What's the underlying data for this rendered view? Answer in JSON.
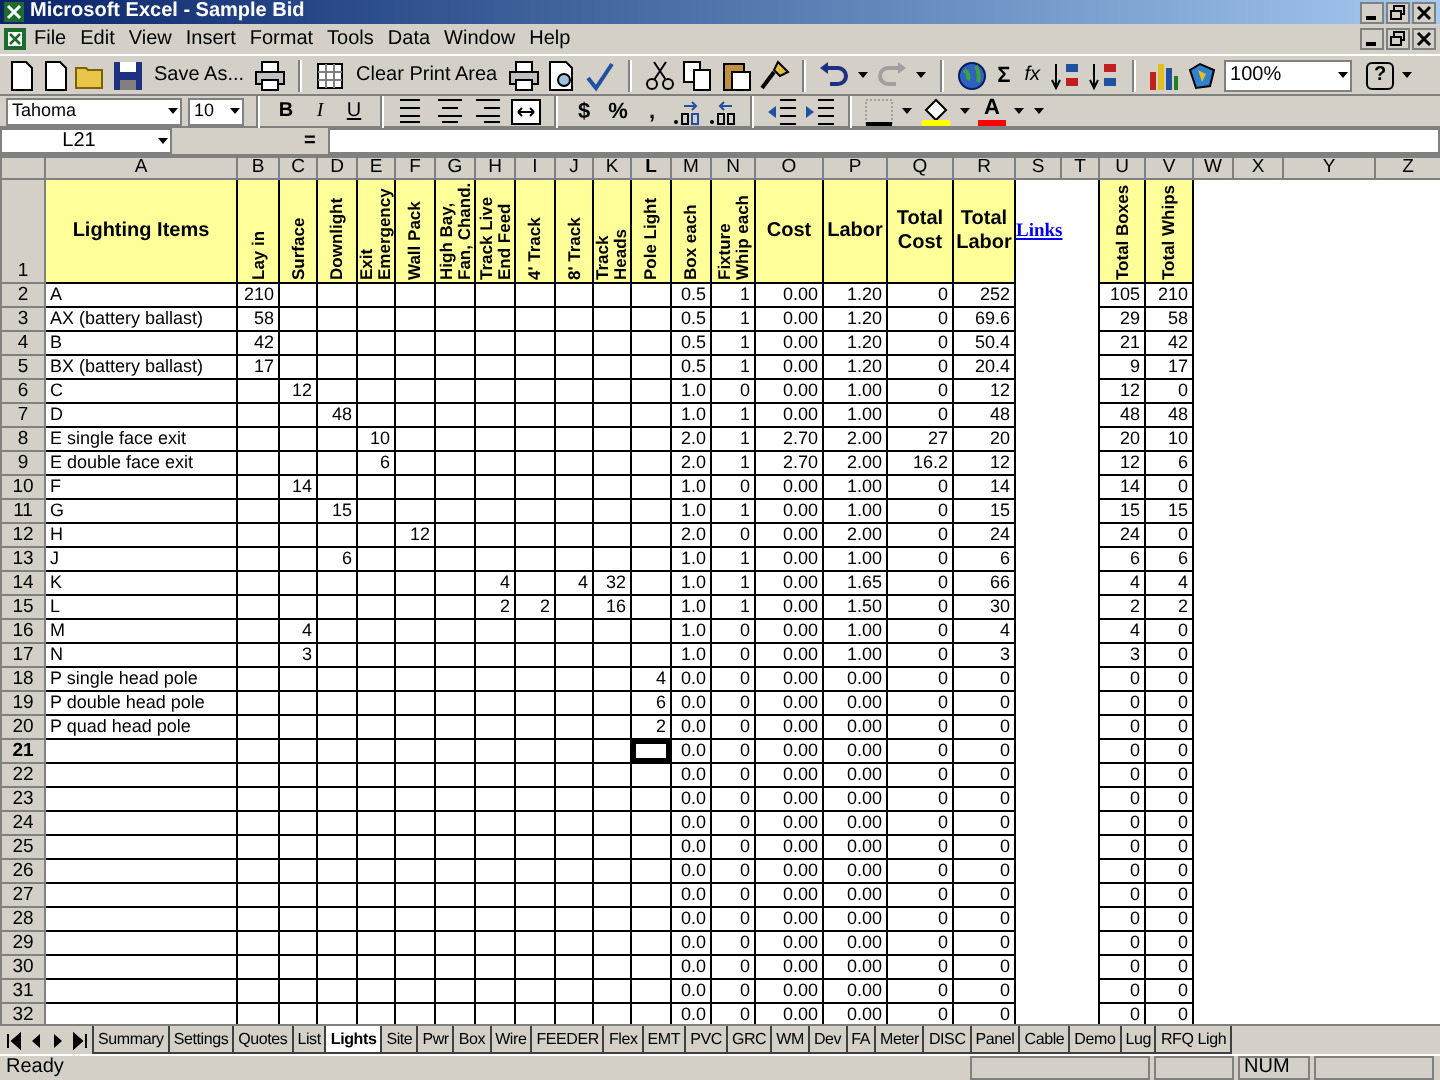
{
  "window": {
    "title": "Microsoft Excel - Sample Bid"
  },
  "menu": [
    "File",
    "Edit",
    "View",
    "Insert",
    "Format",
    "Tools",
    "Data",
    "Window",
    "Help"
  ],
  "toolbar": {
    "save_as": "Save As...",
    "clear_print_area": "Clear Print Area",
    "sum": "Σ",
    "function": "fx",
    "zoom": "100%",
    "help": "?"
  },
  "format_bar": {
    "font": "Tahoma",
    "size": "10",
    "style_buttons": [
      "B",
      "I",
      "U"
    ],
    "number_buttons": [
      "$",
      "%",
      ","
    ],
    "font_color": "A"
  },
  "formula_bar": {
    "name_box": "L21",
    "equals": "="
  },
  "columns": [
    {
      "letter": "A",
      "selected": false
    },
    {
      "letter": "B",
      "selected": false
    },
    {
      "letter": "C",
      "selected": false
    },
    {
      "letter": "D",
      "selected": false
    },
    {
      "letter": "E",
      "selected": false
    },
    {
      "letter": "F",
      "selected": false
    },
    {
      "letter": "G",
      "selected": false
    },
    {
      "letter": "H",
      "selected": false
    },
    {
      "letter": "I",
      "selected": false
    },
    {
      "letter": "J",
      "selected": false
    },
    {
      "letter": "K",
      "selected": false
    },
    {
      "letter": "L",
      "selected": true
    },
    {
      "letter": "M",
      "selected": false
    },
    {
      "letter": "N",
      "selected": false
    },
    {
      "letter": "O",
      "selected": false
    },
    {
      "letter": "P",
      "selected": false
    },
    {
      "letter": "Q",
      "selected": false
    },
    {
      "letter": "R",
      "selected": false
    },
    {
      "letter": "S",
      "selected": false
    },
    {
      "letter": "T",
      "selected": false
    },
    {
      "letter": "U",
      "selected": false
    },
    {
      "letter": "V",
      "selected": false
    },
    {
      "letter": "W",
      "selected": false
    },
    {
      "letter": "X",
      "selected": false
    },
    {
      "letter": "Y",
      "selected": false
    },
    {
      "letter": "Z",
      "selected": false
    }
  ],
  "header_row": {
    "row": "1",
    "cells": [
      {
        "text": "Lighting Items",
        "kind": "horizontal"
      },
      {
        "text": "Lay in",
        "kind": "vertical"
      },
      {
        "text": "Surface",
        "kind": "vertical"
      },
      {
        "text": "Downlight",
        "kind": "vertical"
      },
      {
        "text": "Exit Emergency",
        "kind": "vertical"
      },
      {
        "text": "Wall Pack",
        "kind": "vertical"
      },
      {
        "text": "High Bay, Fan, Chand.",
        "kind": "vertical"
      },
      {
        "text": "Track Live End Feed",
        "kind": "vertical"
      },
      {
        "text": "4' Track",
        "kind": "vertical"
      },
      {
        "text": "8' Track",
        "kind": "vertical"
      },
      {
        "text": "Track Heads",
        "kind": "vertical"
      },
      {
        "text": "Pole Light",
        "kind": "vertical"
      },
      {
        "text": "Box each",
        "kind": "vertical"
      },
      {
        "text": "Fixture Whip each",
        "kind": "vertical"
      },
      {
        "text": "Cost",
        "kind": "horizontal"
      },
      {
        "text": "Labor",
        "kind": "horizontal"
      },
      {
        "text": "Total Cost",
        "kind": "horizontal"
      },
      {
        "text": "Total Labor",
        "kind": "horizontal"
      },
      {
        "text": "Links",
        "kind": "link"
      },
      null,
      {
        "text": "Total Boxes",
        "kind": "vertical"
      },
      {
        "text": "Total Whips",
        "kind": "vertical"
      }
    ]
  },
  "rows": [
    {
      "row": "2",
      "selected": false,
      "cells": [
        "A",
        "210",
        null,
        null,
        null,
        null,
        null,
        null,
        null,
        null,
        null,
        null,
        "0.5",
        "1",
        "0.00",
        "1.20",
        "0",
        "252",
        null,
        null,
        "105",
        "210"
      ]
    },
    {
      "row": "3",
      "selected": false,
      "cells": [
        "AX (battery ballast)",
        "58",
        null,
        null,
        null,
        null,
        null,
        null,
        null,
        null,
        null,
        null,
        "0.5",
        "1",
        "0.00",
        "1.20",
        "0",
        "69.6",
        null,
        null,
        "29",
        "58"
      ]
    },
    {
      "row": "4",
      "selected": false,
      "cells": [
        "B",
        "42",
        null,
        null,
        null,
        null,
        null,
        null,
        null,
        null,
        null,
        null,
        "0.5",
        "1",
        "0.00",
        "1.20",
        "0",
        "50.4",
        null,
        null,
        "21",
        "42"
      ]
    },
    {
      "row": "5",
      "selected": false,
      "cells": [
        "BX (battery ballast)",
        "17",
        null,
        null,
        null,
        null,
        null,
        null,
        null,
        null,
        null,
        null,
        "0.5",
        "1",
        "0.00",
        "1.20",
        "0",
        "20.4",
        null,
        null,
        "9",
        "17"
      ]
    },
    {
      "row": "6",
      "selected": false,
      "cells": [
        "C",
        null,
        "12",
        null,
        null,
        null,
        null,
        null,
        null,
        null,
        null,
        null,
        "1.0",
        "0",
        "0.00",
        "1.00",
        "0",
        "12",
        null,
        null,
        "12",
        "0"
      ]
    },
    {
      "row": "7",
      "selected": false,
      "cells": [
        "D",
        null,
        null,
        "48",
        null,
        null,
        null,
        null,
        null,
        null,
        null,
        null,
        "1.0",
        "1",
        "0.00",
        "1.00",
        "0",
        "48",
        null,
        null,
        "48",
        "48"
      ]
    },
    {
      "row": "8",
      "selected": false,
      "cells": [
        "E single face exit",
        null,
        null,
        null,
        "10",
        null,
        null,
        null,
        null,
        null,
        null,
        null,
        "2.0",
        "1",
        "2.70",
        "2.00",
        "27",
        "20",
        null,
        null,
        "20",
        "10"
      ]
    },
    {
      "row": "9",
      "selected": false,
      "cells": [
        "E double face exit",
        null,
        null,
        null,
        "6",
        null,
        null,
        null,
        null,
        null,
        null,
        null,
        "2.0",
        "1",
        "2.70",
        "2.00",
        "16.2",
        "12",
        null,
        null,
        "12",
        "6"
      ]
    },
    {
      "row": "10",
      "selected": false,
      "cells": [
        "F",
        null,
        "14",
        null,
        null,
        null,
        null,
        null,
        null,
        null,
        null,
        null,
        "1.0",
        "0",
        "0.00",
        "1.00",
        "0",
        "14",
        null,
        null,
        "14",
        "0"
      ]
    },
    {
      "row": "11",
      "selected": false,
      "cells": [
        "G",
        null,
        null,
        "15",
        null,
        null,
        null,
        null,
        null,
        null,
        null,
        null,
        "1.0",
        "1",
        "0.00",
        "1.00",
        "0",
        "15",
        null,
        null,
        "15",
        "15"
      ]
    },
    {
      "row": "12",
      "selected": false,
      "cells": [
        "H",
        null,
        null,
        null,
        null,
        "12",
        null,
        null,
        null,
        null,
        null,
        null,
        "2.0",
        "0",
        "0.00",
        "2.00",
        "0",
        "24",
        null,
        null,
        "24",
        "0"
      ]
    },
    {
      "row": "13",
      "selected": false,
      "cells": [
        "J",
        null,
        null,
        "6",
        null,
        null,
        null,
        null,
        null,
        null,
        null,
        null,
        "1.0",
        "1",
        "0.00",
        "1.00",
        "0",
        "6",
        null,
        null,
        "6",
        "6"
      ]
    },
    {
      "row": "14",
      "selected": false,
      "cells": [
        "K",
        null,
        null,
        null,
        null,
        null,
        null,
        "4",
        null,
        "4",
        "32",
        null,
        "1.0",
        "1",
        "0.00",
        "1.65",
        "0",
        "66",
        null,
        null,
        "4",
        "4"
      ]
    },
    {
      "row": "15",
      "selected": false,
      "cells": [
        "L",
        null,
        null,
        null,
        null,
        null,
        null,
        "2",
        "2",
        null,
        "16",
        null,
        "1.0",
        "1",
        "0.00",
        "1.50",
        "0",
        "30",
        null,
        null,
        "2",
        "2"
      ]
    },
    {
      "row": "16",
      "selected": false,
      "cells": [
        "M",
        null,
        "4",
        null,
        null,
        null,
        null,
        null,
        null,
        null,
        null,
        null,
        "1.0",
        "0",
        "0.00",
        "1.00",
        "0",
        "4",
        null,
        null,
        "4",
        "0"
      ]
    },
    {
      "row": "17",
      "selected": false,
      "cells": [
        "N",
        null,
        "3",
        null,
        null,
        null,
        null,
        null,
        null,
        null,
        null,
        null,
        "1.0",
        "0",
        "0.00",
        "1.00",
        "0",
        "3",
        null,
        null,
        "3",
        "0"
      ]
    },
    {
      "row": "18",
      "selected": false,
      "cells": [
        "P single head pole",
        null,
        null,
        null,
        null,
        null,
        null,
        null,
        null,
        null,
        null,
        "4",
        "0.0",
        "0",
        "0.00",
        "0.00",
        "0",
        "0",
        null,
        null,
        "0",
        "0"
      ]
    },
    {
      "row": "19",
      "selected": false,
      "cells": [
        "P double head pole",
        null,
        null,
        null,
        null,
        null,
        null,
        null,
        null,
        null,
        null,
        "6",
        "0.0",
        "0",
        "0.00",
        "0.00",
        "0",
        "0",
        null,
        null,
        "0",
        "0"
      ]
    },
    {
      "row": "20",
      "selected": false,
      "cells": [
        "P quad head pole",
        null,
        null,
        null,
        null,
        null,
        null,
        null,
        null,
        null,
        null,
        "2",
        "0.0",
        "0",
        "0.00",
        "0.00",
        "0",
        "0",
        null,
        null,
        "0",
        "0"
      ]
    },
    {
      "row": "21",
      "selected": true,
      "cells": [
        null,
        null,
        null,
        null,
        null,
        null,
        null,
        null,
        null,
        null,
        null,
        null,
        "0.0",
        "0",
        "0.00",
        "0.00",
        "0",
        "0",
        null,
        null,
        "0",
        "0"
      ]
    },
    {
      "row": "22",
      "selected": false,
      "cells": [
        null,
        null,
        null,
        null,
        null,
        null,
        null,
        null,
        null,
        null,
        null,
        null,
        "0.0",
        "0",
        "0.00",
        "0.00",
        "0",
        "0",
        null,
        null,
        "0",
        "0"
      ]
    },
    {
      "row": "23",
      "selected": false,
      "cells": [
        null,
        null,
        null,
        null,
        null,
        null,
        null,
        null,
        null,
        null,
        null,
        null,
        "0.0",
        "0",
        "0.00",
        "0.00",
        "0",
        "0",
        null,
        null,
        "0",
        "0"
      ]
    },
    {
      "row": "24",
      "selected": false,
      "cells": [
        null,
        null,
        null,
        null,
        null,
        null,
        null,
        null,
        null,
        null,
        null,
        null,
        "0.0",
        "0",
        "0.00",
        "0.00",
        "0",
        "0",
        null,
        null,
        "0",
        "0"
      ]
    },
    {
      "row": "25",
      "selected": false,
      "cells": [
        null,
        null,
        null,
        null,
        null,
        null,
        null,
        null,
        null,
        null,
        null,
        null,
        "0.0",
        "0",
        "0.00",
        "0.00",
        "0",
        "0",
        null,
        null,
        "0",
        "0"
      ]
    },
    {
      "row": "26",
      "selected": false,
      "cells": [
        null,
        null,
        null,
        null,
        null,
        null,
        null,
        null,
        null,
        null,
        null,
        null,
        "0.0",
        "0",
        "0.00",
        "0.00",
        "0",
        "0",
        null,
        null,
        "0",
        "0"
      ]
    },
    {
      "row": "27",
      "selected": false,
      "cells": [
        null,
        null,
        null,
        null,
        null,
        null,
        null,
        null,
        null,
        null,
        null,
        null,
        "0.0",
        "0",
        "0.00",
        "0.00",
        "0",
        "0",
        null,
        null,
        "0",
        "0"
      ]
    },
    {
      "row": "28",
      "selected": false,
      "cells": [
        null,
        null,
        null,
        null,
        null,
        null,
        null,
        null,
        null,
        null,
        null,
        null,
        "0.0",
        "0",
        "0.00",
        "0.00",
        "0",
        "0",
        null,
        null,
        "0",
        "0"
      ]
    },
    {
      "row": "29",
      "selected": false,
      "cells": [
        null,
        null,
        null,
        null,
        null,
        null,
        null,
        null,
        null,
        null,
        null,
        null,
        "0.0",
        "0",
        "0.00",
        "0.00",
        "0",
        "0",
        null,
        null,
        "0",
        "0"
      ]
    },
    {
      "row": "30",
      "selected": false,
      "cells": [
        null,
        null,
        null,
        null,
        null,
        null,
        null,
        null,
        null,
        null,
        null,
        null,
        "0.0",
        "0",
        "0.00",
        "0.00",
        "0",
        "0",
        null,
        null,
        "0",
        "0"
      ]
    },
    {
      "row": "31",
      "selected": false,
      "cells": [
        null,
        null,
        null,
        null,
        null,
        null,
        null,
        null,
        null,
        null,
        null,
        null,
        "0.0",
        "0",
        "0.00",
        "0.00",
        "0",
        "0",
        null,
        null,
        "0",
        "0"
      ]
    },
    {
      "row": "32",
      "selected": false,
      "cells": [
        null,
        null,
        null,
        null,
        null,
        null,
        null,
        null,
        null,
        null,
        null,
        null,
        "0.0",
        "0",
        "0.00",
        "0.00",
        "0",
        "0",
        null,
        null,
        "0",
        "0"
      ]
    }
  ],
  "sheet_tabs": [
    {
      "label": "Summary",
      "selected": false
    },
    {
      "label": "Settings",
      "selected": false
    },
    {
      "label": "Quotes",
      "selected": false
    },
    {
      "label": "List",
      "selected": false
    },
    {
      "label": "Lights",
      "selected": true
    },
    {
      "label": "Site",
      "selected": false
    },
    {
      "label": "Pwr",
      "selected": false
    },
    {
      "label": "Box",
      "selected": false
    },
    {
      "label": "Wire",
      "selected": false
    },
    {
      "label": "FEEDER",
      "selected": false
    },
    {
      "label": "Flex",
      "selected": false
    },
    {
      "label": "EMT",
      "selected": false
    },
    {
      "label": "PVC",
      "selected": false
    },
    {
      "label": "GRC",
      "selected": false
    },
    {
      "label": "WM",
      "selected": false
    },
    {
      "label": "Dev",
      "selected": false
    },
    {
      "label": "FA",
      "selected": false
    },
    {
      "label": "Meter",
      "selected": false
    },
    {
      "label": "DISC",
      "selected": false
    },
    {
      "label": "Panel",
      "selected": false
    },
    {
      "label": "Cable",
      "selected": false
    },
    {
      "label": "Demo",
      "selected": false
    },
    {
      "label": "Lug",
      "selected": false
    },
    {
      "label": "RFQ Ligh",
      "selected": false
    }
  ],
  "status_bar": {
    "status": "Ready",
    "num": "NUM"
  }
}
